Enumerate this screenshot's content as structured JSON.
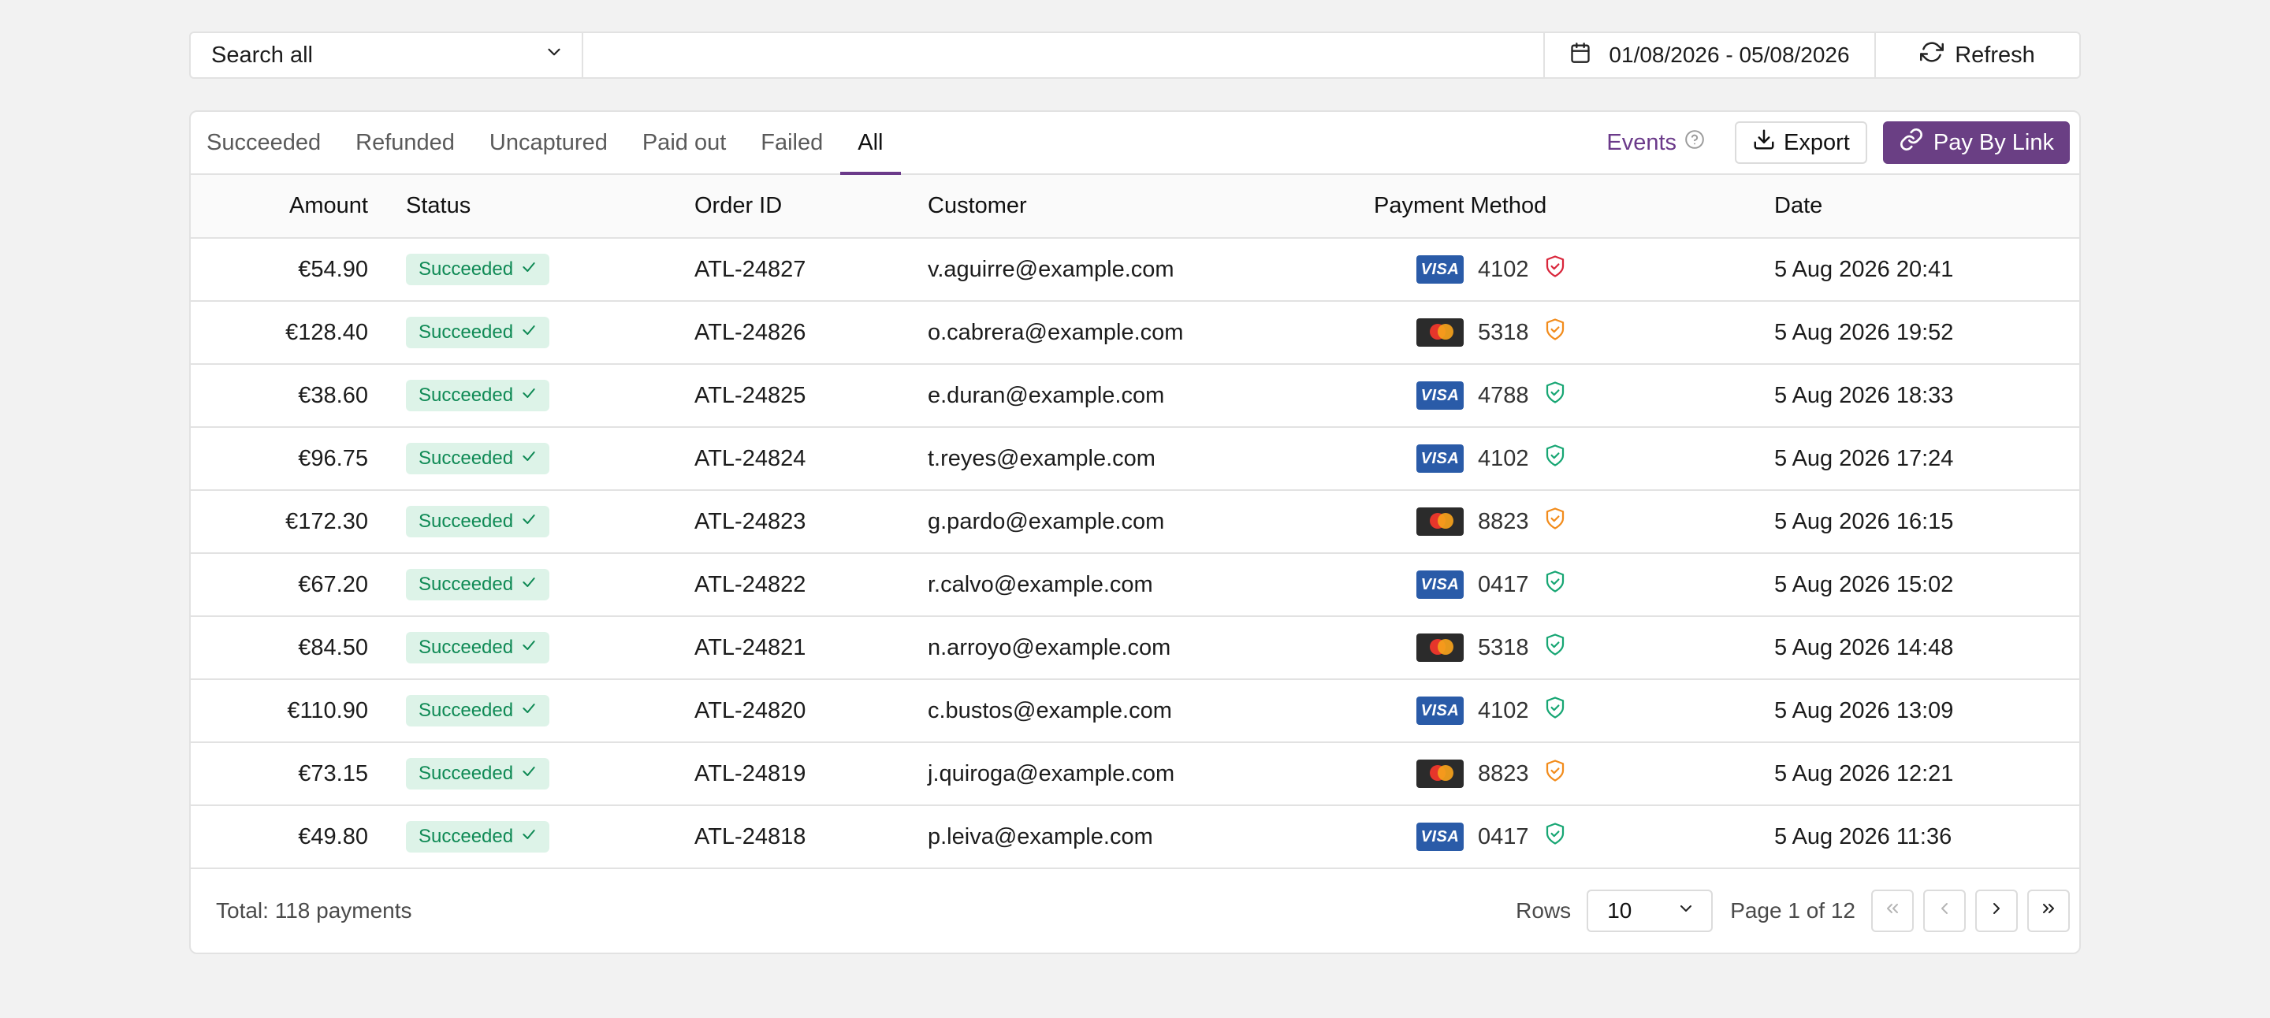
{
  "filters": {
    "search_scope": "Search all",
    "search_placeholder": "",
    "date_range": "01/08/2026 - 05/08/2026",
    "refresh_label": "Refresh"
  },
  "tabs": [
    "Succeeded",
    "Refunded",
    "Uncaptured",
    "Paid out",
    "Failed",
    "All"
  ],
  "active_tab": "All",
  "actions": {
    "events_label": "Events",
    "export_label": "Export",
    "pay_by_link_label": "Pay By Link"
  },
  "columns": {
    "amount": "Amount",
    "status": "Status",
    "order_id": "Order ID",
    "customer": "Customer",
    "payment_method": "Payment Method",
    "date": "Date"
  },
  "rows": [
    {
      "amount": "€54.90",
      "status": "Succeeded",
      "order_id": "ATL-24827",
      "customer": "v.aguirre@example.com",
      "card": "visa",
      "last4": "4102",
      "risk": "high",
      "date": "5 Aug 2026 20:41"
    },
    {
      "amount": "€128.40",
      "status": "Succeeded",
      "order_id": "ATL-24826",
      "customer": "o.cabrera@example.com",
      "card": "mastercard",
      "last4": "5318",
      "risk": "medium",
      "date": "5 Aug 2026 19:52"
    },
    {
      "amount": "€38.60",
      "status": "Succeeded",
      "order_id": "ATL-24825",
      "customer": "e.duran@example.com",
      "card": "visa",
      "last4": "4788",
      "risk": "low",
      "date": "5 Aug 2026 18:33"
    },
    {
      "amount": "€96.75",
      "status": "Succeeded",
      "order_id": "ATL-24824",
      "customer": "t.reyes@example.com",
      "card": "visa",
      "last4": "4102",
      "risk": "low",
      "date": "5 Aug 2026 17:24"
    },
    {
      "amount": "€172.30",
      "status": "Succeeded",
      "order_id": "ATL-24823",
      "customer": "g.pardo@example.com",
      "card": "mastercard",
      "last4": "8823",
      "risk": "medium",
      "date": "5 Aug 2026 16:15"
    },
    {
      "amount": "€67.20",
      "status": "Succeeded",
      "order_id": "ATL-24822",
      "customer": "r.calvo@example.com",
      "card": "visa",
      "last4": "0417",
      "risk": "low",
      "date": "5 Aug 2026 15:02"
    },
    {
      "amount": "€84.50",
      "status": "Succeeded",
      "order_id": "ATL-24821",
      "customer": "n.arroyo@example.com",
      "card": "mastercard",
      "last4": "5318",
      "risk": "low",
      "date": "5 Aug 2026 14:48"
    },
    {
      "amount": "€110.90",
      "status": "Succeeded",
      "order_id": "ATL-24820",
      "customer": "c.bustos@example.com",
      "card": "visa",
      "last4": "4102",
      "risk": "low",
      "date": "5 Aug 2026 13:09"
    },
    {
      "amount": "€73.15",
      "status": "Succeeded",
      "order_id": "ATL-24819",
      "customer": "j.quiroga@example.com",
      "card": "mastercard",
      "last4": "8823",
      "risk": "medium",
      "date": "5 Aug 2026 12:21"
    },
    {
      "amount": "€49.80",
      "status": "Succeeded",
      "order_id": "ATL-24818",
      "customer": "p.leiva@example.com",
      "card": "visa",
      "last4": "0417",
      "risk": "low",
      "date": "5 Aug 2026 11:36"
    }
  ],
  "risk_colors": {
    "high": "#d9263b",
    "medium": "#f28c1c",
    "low": "#17a673"
  },
  "footer": {
    "total": "Total: 118 payments",
    "rows_label": "Rows",
    "rows_value": "10",
    "page_info": "Page 1 of 12"
  },
  "colors": {
    "accent": "#6a3f84",
    "success_bg": "#ddf3e8",
    "success_text": "#0f8a55",
    "visa": "#2a5ba8"
  }
}
